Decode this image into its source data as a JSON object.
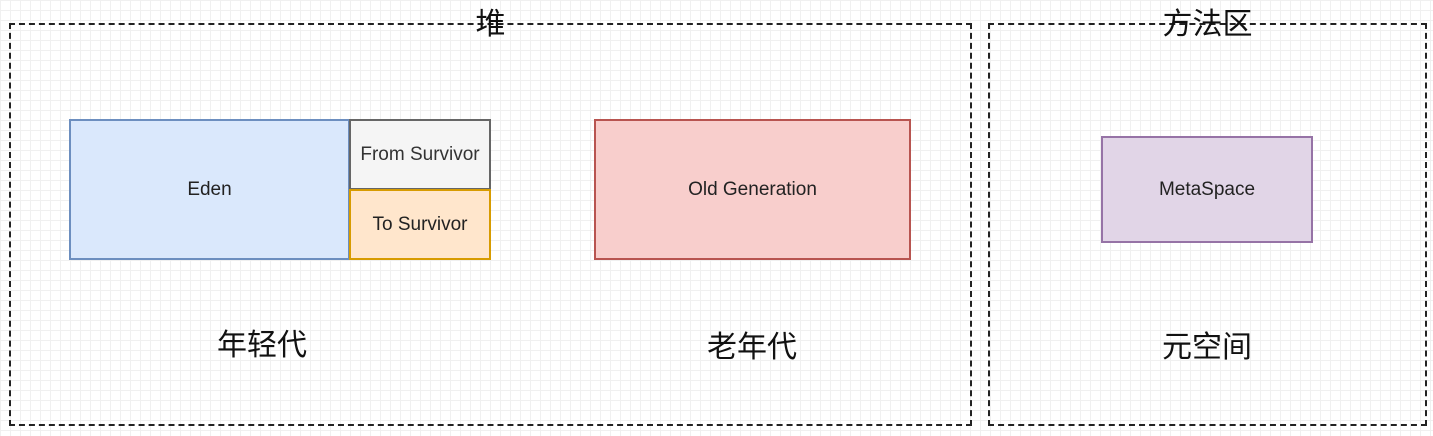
{
  "heap": {
    "title": "堆",
    "young_label": "年轻代",
    "old_label": "老年代",
    "eden": "Eden",
    "from_survivor": "From Survivor",
    "to_survivor": "To Survivor",
    "old_generation": "Old Generation"
  },
  "method_area": {
    "title": "方法区",
    "metaspace": "MetaSpace",
    "metaspace_label": "元空间"
  },
  "colors": {
    "eden_fill": "#dae8fc",
    "eden_border": "#6c8ebf",
    "from_fill": "#f5f5f5",
    "from_border": "#666666",
    "to_fill": "#ffe6cc",
    "to_border": "#d79b00",
    "old_fill": "#f8cecc",
    "old_border": "#b85450",
    "meta_fill": "#e1d5e7",
    "meta_border": "#9673a6"
  }
}
